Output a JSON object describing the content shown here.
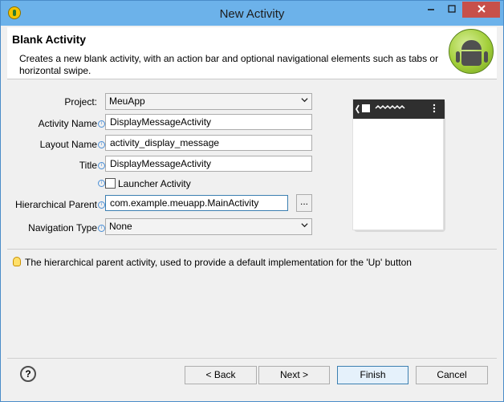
{
  "window": {
    "title": "New Activity"
  },
  "header": {
    "title": "Blank Activity",
    "description": "Creates a new blank activity, with an action bar and optional navigational elements such as tabs or horizontal swipe."
  },
  "form": {
    "project_label": "Project:",
    "project_value": "MeuApp",
    "activity_name_label": "Activity Name",
    "activity_name_value": "DisplayMessageActivity",
    "layout_name_label": "Layout Name",
    "layout_name_value": "activity_display_message",
    "title_label": "Title",
    "title_value": "DisplayMessageActivity",
    "launcher_label": "Launcher Activity",
    "launcher_checked": false,
    "hierarchical_parent_label": "Hierarchical Parent",
    "hierarchical_parent_value": "com.example.meuapp.MainActivity",
    "browse_label": "...",
    "navigation_type_label": "Navigation Type",
    "navigation_type_value": "None"
  },
  "hint": {
    "text": "The hierarchical parent activity, used to provide a default implementation for the 'Up' button"
  },
  "buttons": {
    "back": "< Back",
    "next": "Next >",
    "finish": "Finish",
    "cancel": "Cancel"
  }
}
